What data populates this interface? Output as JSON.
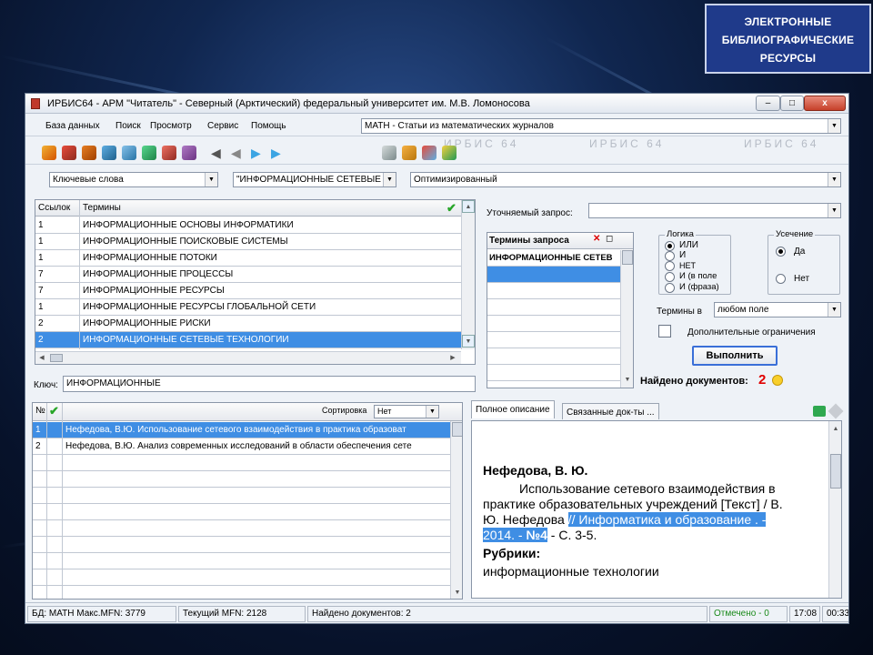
{
  "badge": {
    "line1": "ЭЛЕКТРОННЫЕ",
    "line2": "БИБЛИОГРАФИЧЕСКИЕ",
    "line3": "РЕСУРСЫ"
  },
  "window": {
    "title": "ИРБИС64 - АРМ \"Читатель\" - Северный (Арктический) федеральный университет им. М.В. Ломоносова",
    "btn_min": "–",
    "btn_max": "□",
    "btn_close": "x"
  },
  "menu": [
    "База данных",
    "Поиск",
    "Просмотр",
    "Сервис",
    "Помощь"
  ],
  "database_select": "MATH - Статьи из математических журналов",
  "ghost_text": [
    "ИРБИС 64",
    "ИРБИС 64",
    "ИРБИС 64"
  ],
  "search": {
    "field_select": "Ключевые слова",
    "term_select": "\"ИНФОРМАЦИОННЫЕ СЕТЕВЫЕ",
    "mode_select": "Оптимизированный"
  },
  "dictionary": {
    "col_refs": "Ссылок",
    "col_terms": "Термины",
    "rows": [
      {
        "refs": "1",
        "term": "ИНФОРМАЦИОННЫЕ ОСНОВЫ ИНФОРМАТИКИ"
      },
      {
        "refs": "1",
        "term": "ИНФОРМАЦИОННЫЕ ПОИСКОВЫЕ СИСТЕМЫ"
      },
      {
        "refs": "1",
        "term": "ИНФОРМАЦИОННЫЕ ПОТОКИ"
      },
      {
        "refs": "7",
        "term": "ИНФОРМАЦИОННЫЕ ПРОЦЕССЫ"
      },
      {
        "refs": "7",
        "term": "ИНФОРМАЦИОННЫЕ РЕСУРСЫ"
      },
      {
        "refs": "1",
        "term": "ИНФОРМАЦИОННЫЕ РЕСУРСЫ ГЛОБАЛЬНОЙ СЕТИ"
      },
      {
        "refs": "2",
        "term": "ИНФОРМАЦИОННЫЕ РИСКИ"
      },
      {
        "refs": "2",
        "term": "ИНФОРМАЦИОННЫЕ СЕТЕВЫЕ ТЕХНОЛОГИИ"
      }
    ],
    "key_label": "Ключ:",
    "key_value": "ИНФОРМАЦИОННЫЕ"
  },
  "query": {
    "refine_label": "Уточняемый запрос:",
    "refine_value": "",
    "terms_header": "Термины запроса",
    "term_item": "ИНФОРМАЦИОННЫЕ СЕТЕВ",
    "logic": {
      "title": "Логика",
      "options": [
        "ИЛИ",
        "И",
        "НЕТ",
        "И (в поле",
        "И (фраза)"
      ],
      "selected": "ИЛИ"
    },
    "truncation": {
      "title": "Усечение",
      "yes": "Да",
      "no": "Нет",
      "selected": "Да"
    },
    "terms_in_label": "Термины в",
    "terms_in_value": "любом поле",
    "extra_label": "Дополнительные ограничения",
    "execute": "Выполнить",
    "found_label": "Найдено документов:",
    "found_count": "2"
  },
  "results": {
    "col_num": "№",
    "sort_label": "Сортировка",
    "sort_value": "Нет",
    "rows": [
      {
        "num": "1",
        "text": "Нефедова, В.Ю. Использование сетевого взаимодействия в практика образоват"
      },
      {
        "num": "2",
        "text": "Нефедова, В.Ю. Анализ современных исследований в области обеспечения сете"
      }
    ]
  },
  "description": {
    "tab_full": "Полное описание",
    "tab_linked": "Связанные док-ты ...",
    "author": "Нефедова, В. Ю.",
    "line1": "Использование сетевого взаимодействия в",
    "line2": "практике образовательных учреждений [Текст] / В.",
    "line3_a": "Ю. Нефедова ",
    "line3_b": "// Информатика и образование . -",
    "line4_a": "2014. - ",
    "line4_b": "№4",
    "line4_c": " - С. 3-5.",
    "rubrics_label": "Рубрики:",
    "rubric": "информационные технологии"
  },
  "statusbar": {
    "db": "БД: MATH Макс.MFN: 3779",
    "current": "Текущий MFN: 2128",
    "found": "Найдено документов: 2",
    "marked": "Отмечено - 0",
    "time1": "17:08",
    "time2": "00:33"
  },
  "colors": {
    "selection": "#3f8ee4",
    "badge_bg": "#1f3a8a",
    "found_red": "#e00000",
    "marked_green": "#1a8a1a"
  }
}
